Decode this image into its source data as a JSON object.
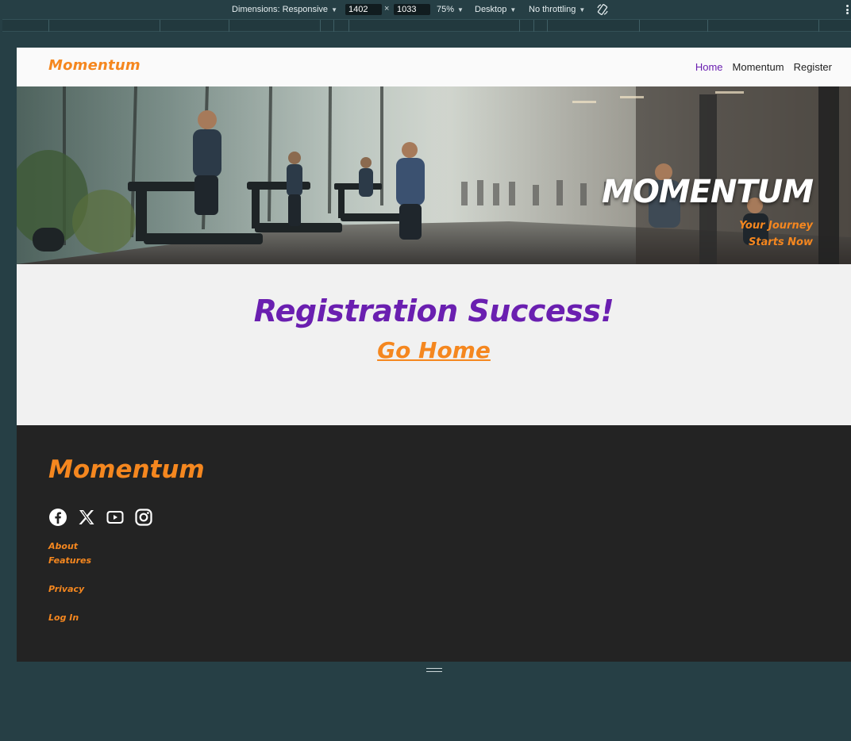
{
  "devtools": {
    "dimensions_label": "Dimensions: Responsive",
    "width_value": "1402",
    "height_value": "1033",
    "times_symbol": "×",
    "zoom": "75%",
    "device_type": "Desktop",
    "throttling": "No throttling"
  },
  "nav": {
    "brand": "Momentum",
    "links": [
      {
        "label": "Home",
        "active": true
      },
      {
        "label": "Momentum",
        "active": false
      },
      {
        "label": "Register",
        "active": false
      }
    ]
  },
  "hero": {
    "title": "MOMENTUM",
    "subtitle_line1": "Your Journey",
    "subtitle_line2": "Starts Now"
  },
  "main": {
    "heading": "Registration Success!",
    "link": "Go Home"
  },
  "footer": {
    "brand": "Momentum",
    "socials": [
      "facebook-icon",
      "x-icon",
      "youtube-icon",
      "instagram-icon"
    ],
    "links": [
      "About",
      "Features",
      "Privacy",
      "Log In"
    ]
  },
  "colors": {
    "accent_orange": "#f5871f",
    "accent_purple": "#6a1fb0",
    "footer_bg": "#232323",
    "devtools_bg": "#263f45"
  }
}
